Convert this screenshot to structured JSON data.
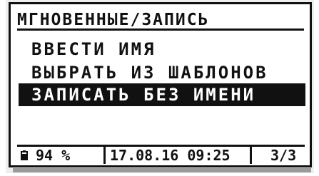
{
  "screen": {
    "title": "МГНОВЕННЫЕ/ЗАПИСЬ",
    "menu": [
      {
        "label": "ВВЕСТИ ИМЯ",
        "selected": false
      },
      {
        "label": "ВЫБРАТЬ ИЗ ШАБЛОНОВ",
        "selected": false
      },
      {
        "label": "ЗАПИСАТЬ БЕЗ ИМЕНИ",
        "selected": true
      }
    ]
  },
  "status": {
    "battery_icon": "battery-icon",
    "battery_text": "94 %",
    "datetime": "17.08.16 09:25",
    "page": "3/3"
  }
}
